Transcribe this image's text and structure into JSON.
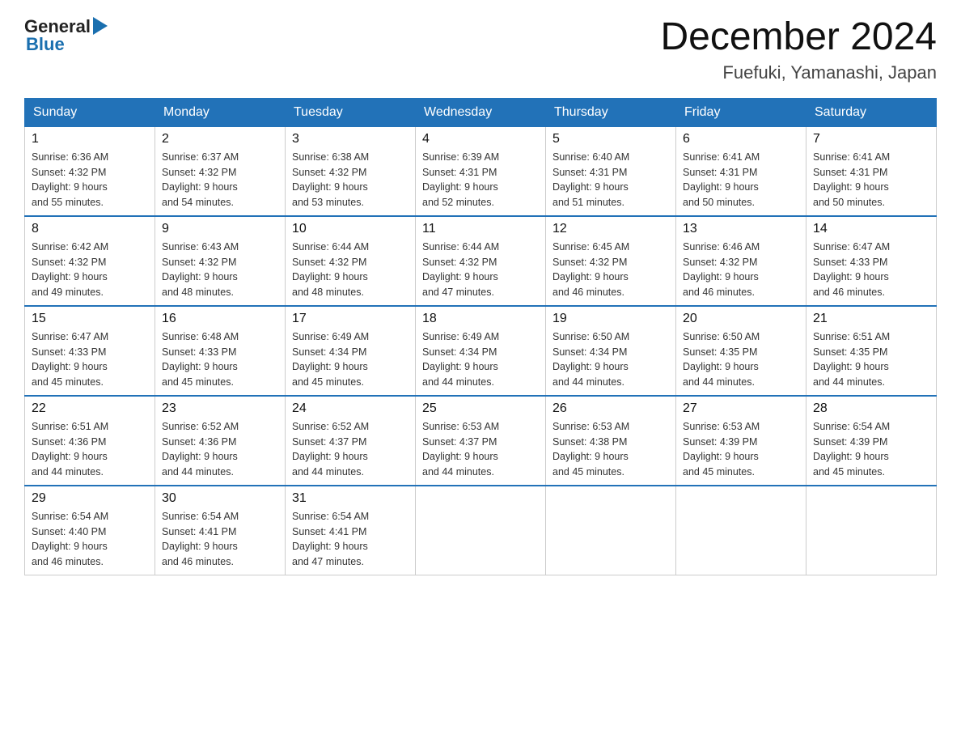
{
  "header": {
    "logo_general": "General",
    "logo_blue": "Blue",
    "title": "December 2024",
    "subtitle": "Fuefuki, Yamanashi, Japan"
  },
  "days_of_week": [
    "Sunday",
    "Monday",
    "Tuesday",
    "Wednesday",
    "Thursday",
    "Friday",
    "Saturday"
  ],
  "weeks": [
    [
      {
        "day": "1",
        "sunrise": "6:36 AM",
        "sunset": "4:32 PM",
        "daylight": "9 hours and 55 minutes."
      },
      {
        "day": "2",
        "sunrise": "6:37 AM",
        "sunset": "4:32 PM",
        "daylight": "9 hours and 54 minutes."
      },
      {
        "day": "3",
        "sunrise": "6:38 AM",
        "sunset": "4:32 PM",
        "daylight": "9 hours and 53 minutes."
      },
      {
        "day": "4",
        "sunrise": "6:39 AM",
        "sunset": "4:31 PM",
        "daylight": "9 hours and 52 minutes."
      },
      {
        "day": "5",
        "sunrise": "6:40 AM",
        "sunset": "4:31 PM",
        "daylight": "9 hours and 51 minutes."
      },
      {
        "day": "6",
        "sunrise": "6:41 AM",
        "sunset": "4:31 PM",
        "daylight": "9 hours and 50 minutes."
      },
      {
        "day": "7",
        "sunrise": "6:41 AM",
        "sunset": "4:31 PM",
        "daylight": "9 hours and 50 minutes."
      }
    ],
    [
      {
        "day": "8",
        "sunrise": "6:42 AM",
        "sunset": "4:32 PM",
        "daylight": "9 hours and 49 minutes."
      },
      {
        "day": "9",
        "sunrise": "6:43 AM",
        "sunset": "4:32 PM",
        "daylight": "9 hours and 48 minutes."
      },
      {
        "day": "10",
        "sunrise": "6:44 AM",
        "sunset": "4:32 PM",
        "daylight": "9 hours and 48 minutes."
      },
      {
        "day": "11",
        "sunrise": "6:44 AM",
        "sunset": "4:32 PM",
        "daylight": "9 hours and 47 minutes."
      },
      {
        "day": "12",
        "sunrise": "6:45 AM",
        "sunset": "4:32 PM",
        "daylight": "9 hours and 46 minutes."
      },
      {
        "day": "13",
        "sunrise": "6:46 AM",
        "sunset": "4:32 PM",
        "daylight": "9 hours and 46 minutes."
      },
      {
        "day": "14",
        "sunrise": "6:47 AM",
        "sunset": "4:33 PM",
        "daylight": "9 hours and 46 minutes."
      }
    ],
    [
      {
        "day": "15",
        "sunrise": "6:47 AM",
        "sunset": "4:33 PM",
        "daylight": "9 hours and 45 minutes."
      },
      {
        "day": "16",
        "sunrise": "6:48 AM",
        "sunset": "4:33 PM",
        "daylight": "9 hours and 45 minutes."
      },
      {
        "day": "17",
        "sunrise": "6:49 AM",
        "sunset": "4:34 PM",
        "daylight": "9 hours and 45 minutes."
      },
      {
        "day": "18",
        "sunrise": "6:49 AM",
        "sunset": "4:34 PM",
        "daylight": "9 hours and 44 minutes."
      },
      {
        "day": "19",
        "sunrise": "6:50 AM",
        "sunset": "4:34 PM",
        "daylight": "9 hours and 44 minutes."
      },
      {
        "day": "20",
        "sunrise": "6:50 AM",
        "sunset": "4:35 PM",
        "daylight": "9 hours and 44 minutes."
      },
      {
        "day": "21",
        "sunrise": "6:51 AM",
        "sunset": "4:35 PM",
        "daylight": "9 hours and 44 minutes."
      }
    ],
    [
      {
        "day": "22",
        "sunrise": "6:51 AM",
        "sunset": "4:36 PM",
        "daylight": "9 hours and 44 minutes."
      },
      {
        "day": "23",
        "sunrise": "6:52 AM",
        "sunset": "4:36 PM",
        "daylight": "9 hours and 44 minutes."
      },
      {
        "day": "24",
        "sunrise": "6:52 AM",
        "sunset": "4:37 PM",
        "daylight": "9 hours and 44 minutes."
      },
      {
        "day": "25",
        "sunrise": "6:53 AM",
        "sunset": "4:37 PM",
        "daylight": "9 hours and 44 minutes."
      },
      {
        "day": "26",
        "sunrise": "6:53 AM",
        "sunset": "4:38 PM",
        "daylight": "9 hours and 45 minutes."
      },
      {
        "day": "27",
        "sunrise": "6:53 AM",
        "sunset": "4:39 PM",
        "daylight": "9 hours and 45 minutes."
      },
      {
        "day": "28",
        "sunrise": "6:54 AM",
        "sunset": "4:39 PM",
        "daylight": "9 hours and 45 minutes."
      }
    ],
    [
      {
        "day": "29",
        "sunrise": "6:54 AM",
        "sunset": "4:40 PM",
        "daylight": "9 hours and 46 minutes."
      },
      {
        "day": "30",
        "sunrise": "6:54 AM",
        "sunset": "4:41 PM",
        "daylight": "9 hours and 46 minutes."
      },
      {
        "day": "31",
        "sunrise": "6:54 AM",
        "sunset": "4:41 PM",
        "daylight": "9 hours and 47 minutes."
      },
      null,
      null,
      null,
      null
    ]
  ]
}
